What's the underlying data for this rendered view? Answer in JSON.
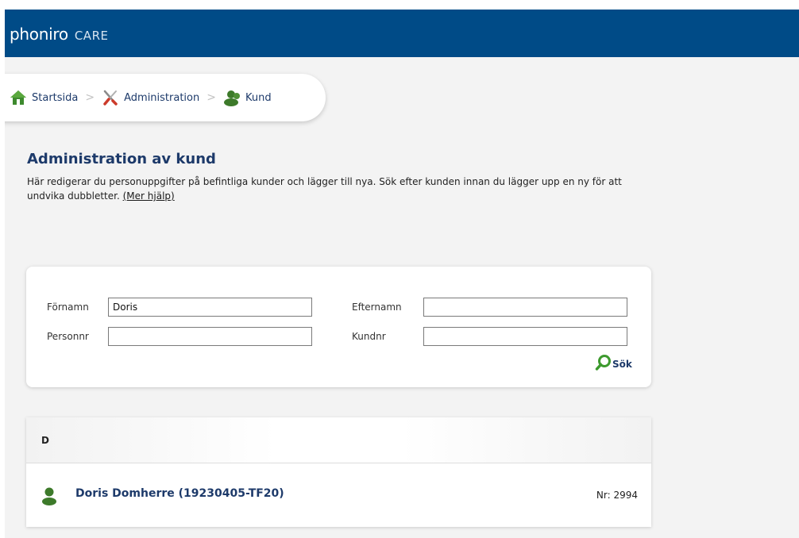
{
  "app": {
    "brand": "phoniro",
    "product": "CARE"
  },
  "breadcrumb": {
    "items": [
      {
        "label": "Startsida",
        "icon": "home-icon"
      },
      {
        "label": "Administration",
        "icon": "tools-icon"
      },
      {
        "label": "Kund",
        "icon": "customer-icon"
      }
    ],
    "separator": ">"
  },
  "page": {
    "title": "Administration av kund",
    "intro": "Här redigerar du personuppgifter på befintliga kunder och lägger till nya. Sök efter kunden innan du lägger upp en ny för att undvika dubbletter.",
    "help_link": "(Mer hjälp)"
  },
  "search": {
    "fornamn_label": "Förnamn",
    "fornamn_value": "Doris",
    "efternamn_label": "Efternamn",
    "efternamn_value": "",
    "personnr_label": "Personnr",
    "personnr_value": "",
    "kundnr_label": "Kundnr",
    "kundnr_value": "",
    "button_label": "Sök"
  },
  "results": {
    "groups": [
      {
        "letter": "D",
        "rows": [
          {
            "name": "Doris Domherre (19230405-TF20)",
            "nr": "Nr: 2994"
          }
        ]
      }
    ]
  },
  "colors": {
    "topbar": "#004b87",
    "link": "#1d3a6a",
    "icon_green": "#3d7a2a"
  }
}
